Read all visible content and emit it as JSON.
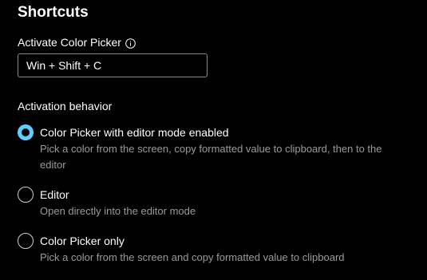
{
  "section": {
    "title": "Shortcuts"
  },
  "activate": {
    "label": "Activate Color Picker",
    "info_icon": "info-icon",
    "value": "Win + Shift + C"
  },
  "behavior": {
    "label": "Activation behavior",
    "options": [
      {
        "title": "Color Picker with editor mode enabled",
        "description": "Pick a color from the screen, copy formatted value to clipboard, then to the editor",
        "selected": true
      },
      {
        "title": "Editor",
        "description": "Open directly into the editor mode",
        "selected": false
      },
      {
        "title": "Color Picker only",
        "description": "Pick a color from the screen and copy formatted value to clipboard",
        "selected": false
      }
    ]
  },
  "colors": {
    "accent": "#60cdff",
    "background": "#000000",
    "secondary_text": "#9a9a9a"
  }
}
